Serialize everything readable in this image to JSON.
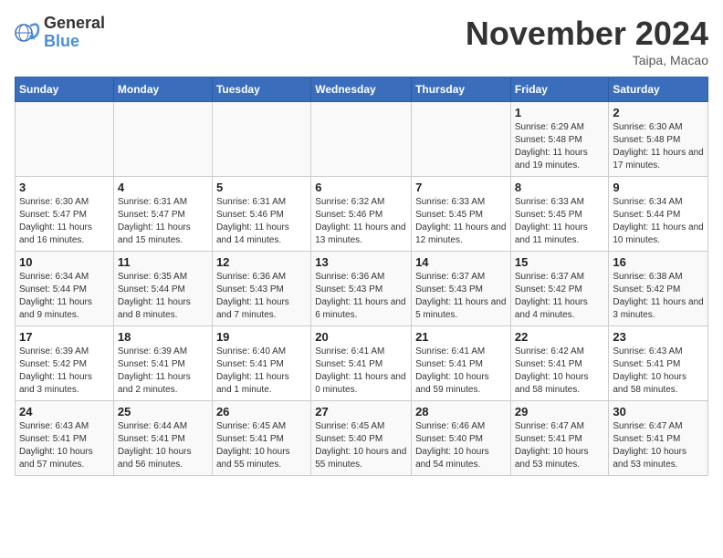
{
  "header": {
    "logo_general": "General",
    "logo_blue": "Blue",
    "month_title": "November 2024",
    "location": "Taipa, Macao"
  },
  "days_of_week": [
    "Sunday",
    "Monday",
    "Tuesday",
    "Wednesday",
    "Thursday",
    "Friday",
    "Saturday"
  ],
  "weeks": [
    [
      {
        "day": "",
        "info": ""
      },
      {
        "day": "",
        "info": ""
      },
      {
        "day": "",
        "info": ""
      },
      {
        "day": "",
        "info": ""
      },
      {
        "day": "",
        "info": ""
      },
      {
        "day": "1",
        "info": "Sunrise: 6:29 AM\nSunset: 5:48 PM\nDaylight: 11 hours and 19 minutes."
      },
      {
        "day": "2",
        "info": "Sunrise: 6:30 AM\nSunset: 5:48 PM\nDaylight: 11 hours and 17 minutes."
      }
    ],
    [
      {
        "day": "3",
        "info": "Sunrise: 6:30 AM\nSunset: 5:47 PM\nDaylight: 11 hours and 16 minutes."
      },
      {
        "day": "4",
        "info": "Sunrise: 6:31 AM\nSunset: 5:47 PM\nDaylight: 11 hours and 15 minutes."
      },
      {
        "day": "5",
        "info": "Sunrise: 6:31 AM\nSunset: 5:46 PM\nDaylight: 11 hours and 14 minutes."
      },
      {
        "day": "6",
        "info": "Sunrise: 6:32 AM\nSunset: 5:46 PM\nDaylight: 11 hours and 13 minutes."
      },
      {
        "day": "7",
        "info": "Sunrise: 6:33 AM\nSunset: 5:45 PM\nDaylight: 11 hours and 12 minutes."
      },
      {
        "day": "8",
        "info": "Sunrise: 6:33 AM\nSunset: 5:45 PM\nDaylight: 11 hours and 11 minutes."
      },
      {
        "day": "9",
        "info": "Sunrise: 6:34 AM\nSunset: 5:44 PM\nDaylight: 11 hours and 10 minutes."
      }
    ],
    [
      {
        "day": "10",
        "info": "Sunrise: 6:34 AM\nSunset: 5:44 PM\nDaylight: 11 hours and 9 minutes."
      },
      {
        "day": "11",
        "info": "Sunrise: 6:35 AM\nSunset: 5:44 PM\nDaylight: 11 hours and 8 minutes."
      },
      {
        "day": "12",
        "info": "Sunrise: 6:36 AM\nSunset: 5:43 PM\nDaylight: 11 hours and 7 minutes."
      },
      {
        "day": "13",
        "info": "Sunrise: 6:36 AM\nSunset: 5:43 PM\nDaylight: 11 hours and 6 minutes."
      },
      {
        "day": "14",
        "info": "Sunrise: 6:37 AM\nSunset: 5:43 PM\nDaylight: 11 hours and 5 minutes."
      },
      {
        "day": "15",
        "info": "Sunrise: 6:37 AM\nSunset: 5:42 PM\nDaylight: 11 hours and 4 minutes."
      },
      {
        "day": "16",
        "info": "Sunrise: 6:38 AM\nSunset: 5:42 PM\nDaylight: 11 hours and 3 minutes."
      }
    ],
    [
      {
        "day": "17",
        "info": "Sunrise: 6:39 AM\nSunset: 5:42 PM\nDaylight: 11 hours and 3 minutes."
      },
      {
        "day": "18",
        "info": "Sunrise: 6:39 AM\nSunset: 5:41 PM\nDaylight: 11 hours and 2 minutes."
      },
      {
        "day": "19",
        "info": "Sunrise: 6:40 AM\nSunset: 5:41 PM\nDaylight: 11 hours and 1 minute."
      },
      {
        "day": "20",
        "info": "Sunrise: 6:41 AM\nSunset: 5:41 PM\nDaylight: 11 hours and 0 minutes."
      },
      {
        "day": "21",
        "info": "Sunrise: 6:41 AM\nSunset: 5:41 PM\nDaylight: 10 hours and 59 minutes."
      },
      {
        "day": "22",
        "info": "Sunrise: 6:42 AM\nSunset: 5:41 PM\nDaylight: 10 hours and 58 minutes."
      },
      {
        "day": "23",
        "info": "Sunrise: 6:43 AM\nSunset: 5:41 PM\nDaylight: 10 hours and 58 minutes."
      }
    ],
    [
      {
        "day": "24",
        "info": "Sunrise: 6:43 AM\nSunset: 5:41 PM\nDaylight: 10 hours and 57 minutes."
      },
      {
        "day": "25",
        "info": "Sunrise: 6:44 AM\nSunset: 5:41 PM\nDaylight: 10 hours and 56 minutes."
      },
      {
        "day": "26",
        "info": "Sunrise: 6:45 AM\nSunset: 5:41 PM\nDaylight: 10 hours and 55 minutes."
      },
      {
        "day": "27",
        "info": "Sunrise: 6:45 AM\nSunset: 5:40 PM\nDaylight: 10 hours and 55 minutes."
      },
      {
        "day": "28",
        "info": "Sunrise: 6:46 AM\nSunset: 5:40 PM\nDaylight: 10 hours and 54 minutes."
      },
      {
        "day": "29",
        "info": "Sunrise: 6:47 AM\nSunset: 5:41 PM\nDaylight: 10 hours and 53 minutes."
      },
      {
        "day": "30",
        "info": "Sunrise: 6:47 AM\nSunset: 5:41 PM\nDaylight: 10 hours and 53 minutes."
      }
    ]
  ]
}
